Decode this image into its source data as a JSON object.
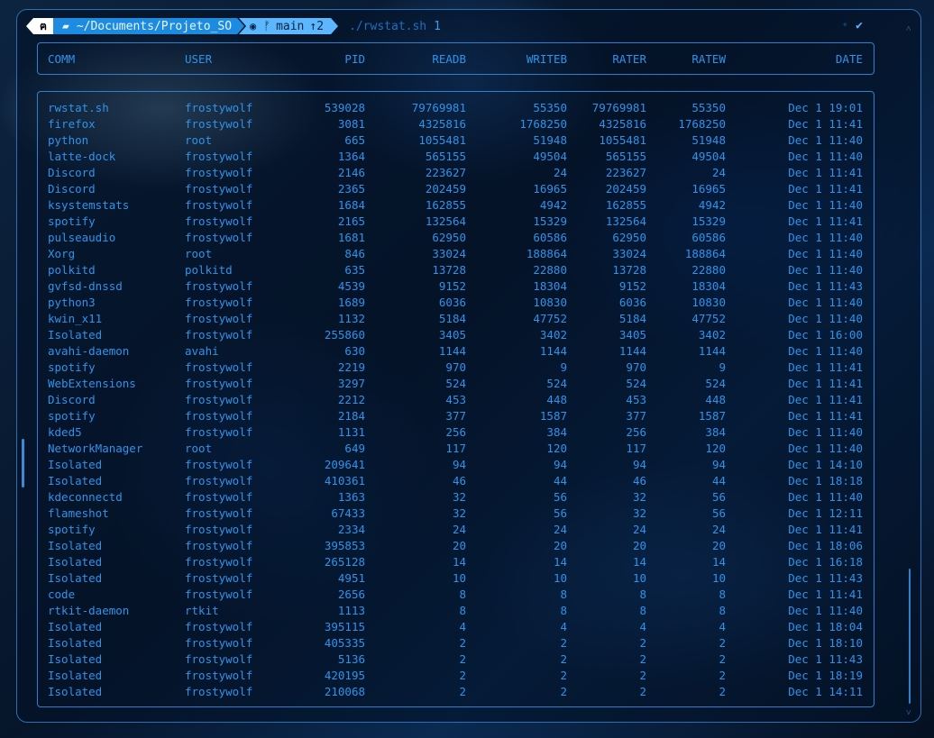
{
  "prompt": {
    "os_icon": "arch-linux-icon",
    "folder_icon": "folder-open-icon",
    "path": "~/Documents/Projeto_SO",
    "git_icon": "github-cat-icon",
    "branch_icon": "git-branch-icon",
    "branch": "main",
    "ahead": "↑2",
    "command": "./rwstat.sh",
    "argument": "1",
    "status_icon": "checkmark-icon",
    "colors": {
      "path_segment": "#1d8ce0",
      "git_segment": "#5cb7ff",
      "text": "#2f93ea",
      "border": "#2f80c8"
    }
  },
  "table": {
    "headers": [
      "COMM",
      "USER",
      "PID",
      "READB",
      "WRITEB",
      "RATER",
      "RATEW",
      "DATE"
    ],
    "rows": [
      [
        "rwstat.sh",
        "frostywolf",
        "539028",
        "79769981",
        "55350",
        "79769981",
        "55350",
        "Dec 1 19:01"
      ],
      [
        "firefox",
        "frostywolf",
        "3081",
        "4325816",
        "1768250",
        "4325816",
        "1768250",
        "Dec 1 11:41"
      ],
      [
        "python",
        "root",
        "665",
        "1055481",
        "51948",
        "1055481",
        "51948",
        "Dec 1 11:40"
      ],
      [
        "latte-dock",
        "frostywolf",
        "1364",
        "565155",
        "49504",
        "565155",
        "49504",
        "Dec 1 11:40"
      ],
      [
        "Discord",
        "frostywolf",
        "2146",
        "223627",
        "24",
        "223627",
        "24",
        "Dec 1 11:41"
      ],
      [
        "Discord",
        "frostywolf",
        "2365",
        "202459",
        "16965",
        "202459",
        "16965",
        "Dec 1 11:41"
      ],
      [
        "ksystemstats",
        "frostywolf",
        "1684",
        "162855",
        "4942",
        "162855",
        "4942",
        "Dec 1 11:40"
      ],
      [
        "spotify",
        "frostywolf",
        "2165",
        "132564",
        "15329",
        "132564",
        "15329",
        "Dec 1 11:41"
      ],
      [
        "pulseaudio",
        "frostywolf",
        "1681",
        "62950",
        "60586",
        "62950",
        "60586",
        "Dec 1 11:40"
      ],
      [
        "Xorg",
        "root",
        "846",
        "33024",
        "188864",
        "33024",
        "188864",
        "Dec 1 11:40"
      ],
      [
        "polkitd",
        "polkitd",
        "635",
        "13728",
        "22880",
        "13728",
        "22880",
        "Dec 1 11:40"
      ],
      [
        "gvfsd-dnssd",
        "frostywolf",
        "4539",
        "9152",
        "18304",
        "9152",
        "18304",
        "Dec 1 11:43"
      ],
      [
        "python3",
        "frostywolf",
        "1689",
        "6036",
        "10830",
        "6036",
        "10830",
        "Dec 1 11:40"
      ],
      [
        "kwin_x11",
        "frostywolf",
        "1132",
        "5184",
        "47752",
        "5184",
        "47752",
        "Dec 1 11:40"
      ],
      [
        "Isolated",
        "frostywolf",
        "255860",
        "3405",
        "3402",
        "3405",
        "3402",
        "Dec 1 16:00"
      ],
      [
        "avahi-daemon",
        "avahi",
        "630",
        "1144",
        "1144",
        "1144",
        "1144",
        "Dec 1 11:40"
      ],
      [
        "spotify",
        "frostywolf",
        "2219",
        "970",
        "9",
        "970",
        "9",
        "Dec 1 11:41"
      ],
      [
        "WebExtensions",
        "frostywolf",
        "3297",
        "524",
        "524",
        "524",
        "524",
        "Dec 1 11:41"
      ],
      [
        "Discord",
        "frostywolf",
        "2212",
        "453",
        "448",
        "453",
        "448",
        "Dec 1 11:41"
      ],
      [
        "spotify",
        "frostywolf",
        "2184",
        "377",
        "1587",
        "377",
        "1587",
        "Dec 1 11:41"
      ],
      [
        "kded5",
        "frostywolf",
        "1131",
        "256",
        "384",
        "256",
        "384",
        "Dec 1 11:40"
      ],
      [
        "NetworkManager",
        "root",
        "649",
        "117",
        "120",
        "117",
        "120",
        "Dec 1 11:40"
      ],
      [
        "Isolated",
        "frostywolf",
        "209641",
        "94",
        "94",
        "94",
        "94",
        "Dec 1 14:10"
      ],
      [
        "Isolated",
        "frostywolf",
        "410361",
        "46",
        "44",
        "46",
        "44",
        "Dec 1 18:18"
      ],
      [
        "kdeconnectd",
        "frostywolf",
        "1363",
        "32",
        "56",
        "32",
        "56",
        "Dec 1 11:40"
      ],
      [
        "flameshot",
        "frostywolf",
        "67433",
        "32",
        "56",
        "32",
        "56",
        "Dec 1 12:11"
      ],
      [
        "spotify",
        "frostywolf",
        "2334",
        "24",
        "24",
        "24",
        "24",
        "Dec 1 11:41"
      ],
      [
        "Isolated",
        "frostywolf",
        "395853",
        "20",
        "20",
        "20",
        "20",
        "Dec 1 18:06"
      ],
      [
        "Isolated",
        "frostywolf",
        "265128",
        "14",
        "14",
        "14",
        "14",
        "Dec 1 16:18"
      ],
      [
        "Isolated",
        "frostywolf",
        "4951",
        "10",
        "10",
        "10",
        "10",
        "Dec 1 11:43"
      ],
      [
        "code",
        "frostywolf",
        "2656",
        "8",
        "8",
        "8",
        "8",
        "Dec 1 11:41"
      ],
      [
        "rtkit-daemon",
        "rtkit",
        "1113",
        "8",
        "8",
        "8",
        "8",
        "Dec 1 11:40"
      ],
      [
        "Isolated",
        "frostywolf",
        "395115",
        "4",
        "4",
        "4",
        "4",
        "Dec 1 18:04"
      ],
      [
        "Isolated",
        "frostywolf",
        "405335",
        "2",
        "2",
        "2",
        "2",
        "Dec 1 18:10"
      ],
      [
        "Isolated",
        "frostywolf",
        "5136",
        "2",
        "2",
        "2",
        "2",
        "Dec 1 11:43"
      ],
      [
        "Isolated",
        "frostywolf",
        "420195",
        "2",
        "2",
        "2",
        "2",
        "Dec 1 18:19"
      ],
      [
        "Isolated",
        "frostywolf",
        "210068",
        "2",
        "2",
        "2",
        "2",
        "Dec 1 14:11"
      ]
    ]
  },
  "scrollbar": {
    "up_icon": "chevron-up-icon",
    "down_icon": "chevron-down-icon"
  }
}
